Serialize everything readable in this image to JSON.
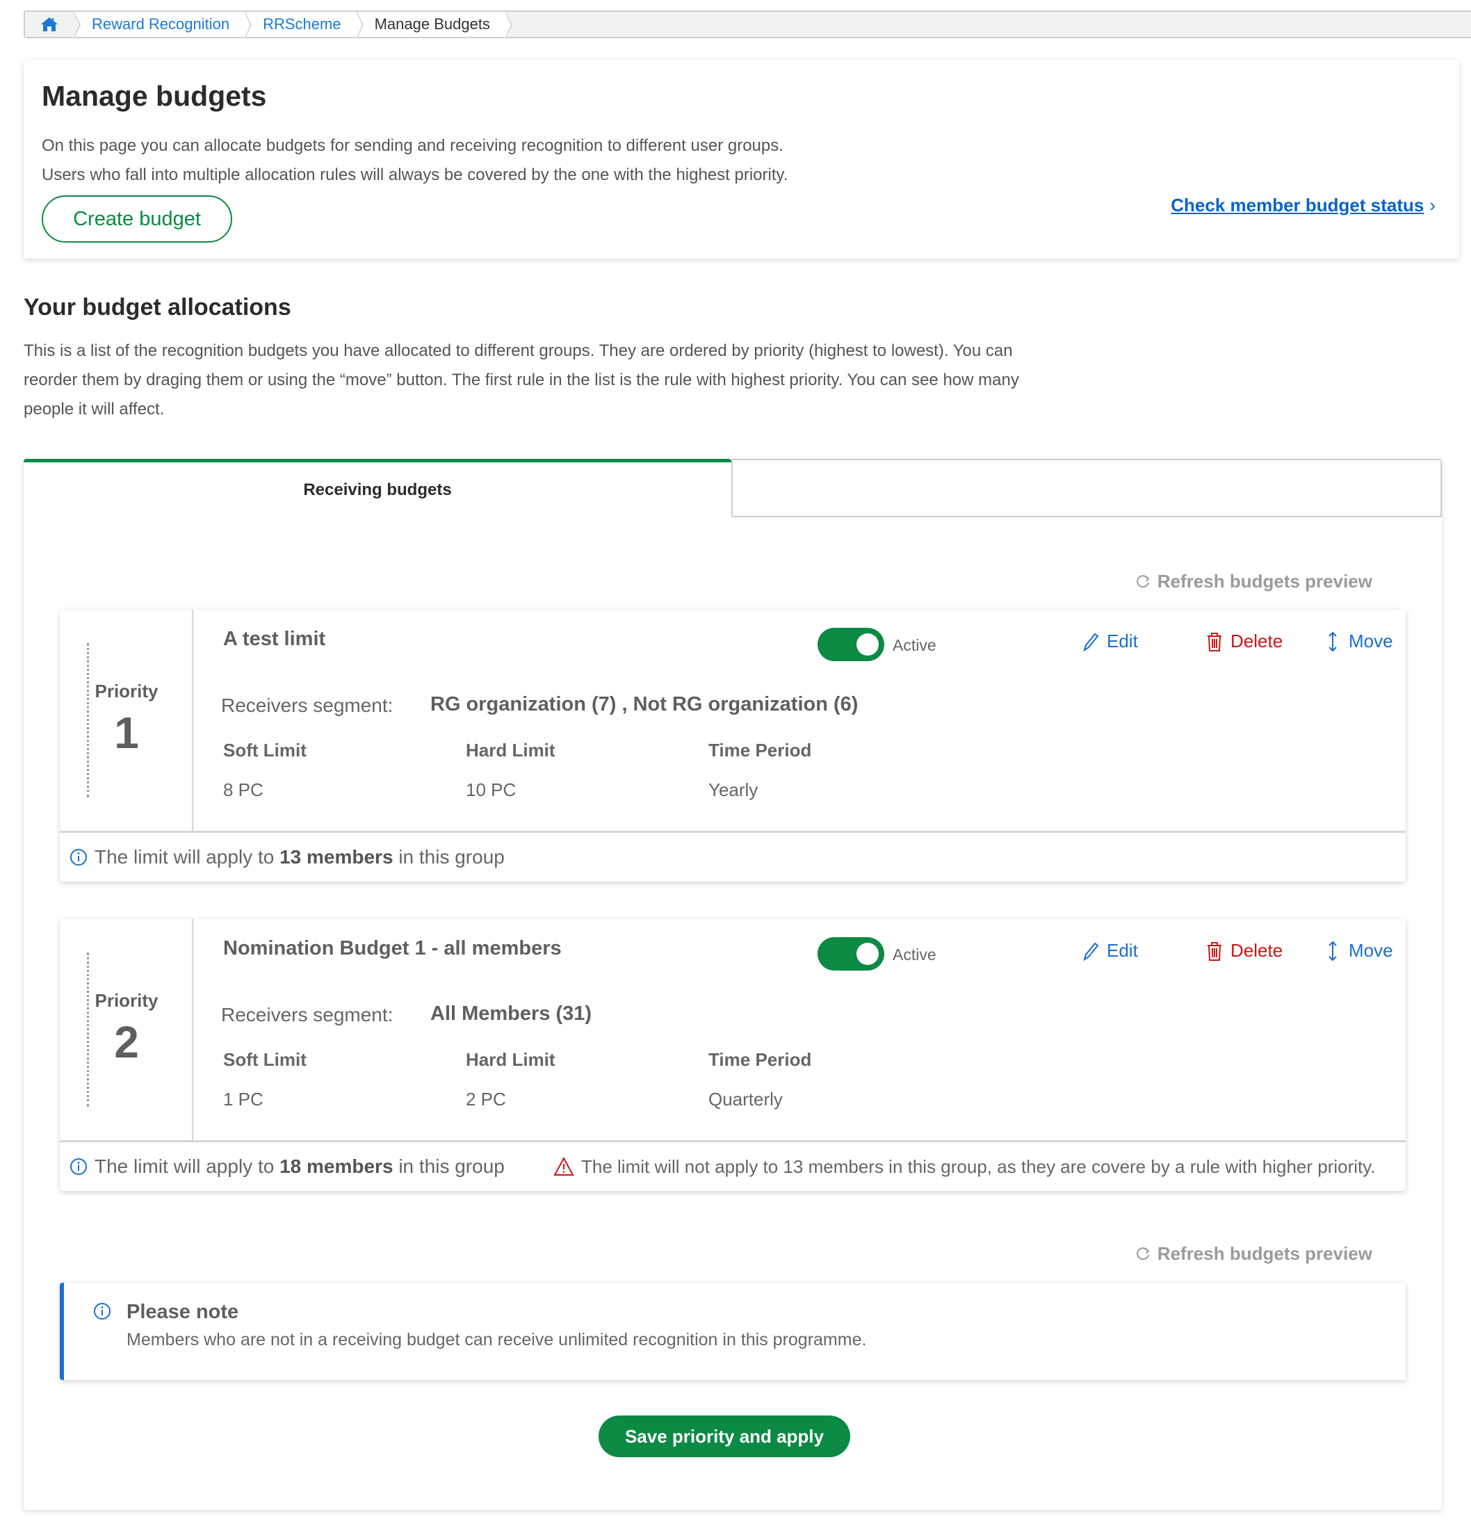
{
  "breadcrumb": {
    "home_icon": "home-icon",
    "items": [
      {
        "label": "Reward Recognition",
        "link": true
      },
      {
        "label": "RRScheme",
        "link": true
      },
      {
        "label": "Manage Budgets",
        "link": false
      }
    ]
  },
  "header": {
    "title": "Manage budgets",
    "intro_line1": "On this page you can allocate budgets for sending and receiving recognition to different user groups.",
    "intro_line2": "Users who fall into multiple allocation rules will always be covered by the one with the highest priority.",
    "create_button": "Create budget",
    "check_link": "Check member budget status",
    "check_link_chevron": "›"
  },
  "allocations": {
    "title": "Your budget allocations",
    "description": "This is a list of the recognition budgets you have allocated to different groups. They are ordered by priority (highest to lowest). You can reorder them by draging them or using the “move” button. The first rule in the list is the rule with highest priority. You can see how many people it will affect."
  },
  "tabs": [
    {
      "label": "Receiving budgets",
      "active": true
    },
    {
      "label": "",
      "active": false
    }
  ],
  "refresh_label": "Refresh budgets preview",
  "labels": {
    "priority": "Priority",
    "active": "Active",
    "edit": "Edit",
    "delete": "Delete",
    "move": "Move",
    "receivers_segment": "Receivers segment:",
    "soft_limit": "Soft Limit",
    "hard_limit": "Hard Limit",
    "time_period": "Time Period",
    "apply_prefix": "The limit will apply to",
    "apply_suffix": "in this group"
  },
  "budgets": [
    {
      "priority": "1",
      "name": "A test limit",
      "active": true,
      "segment": "RG organization (7) , Not RG organization (6)",
      "soft_limit": "8 PC",
      "hard_limit": "10 PC",
      "time_period": "Yearly",
      "members": "13 members",
      "warning": ""
    },
    {
      "priority": "2",
      "name": "Nomination Budget 1 - all members",
      "active": true,
      "segment": "All Members (31)",
      "soft_limit": "1 PC",
      "hard_limit": "2 PC",
      "time_period": "Quarterly",
      "members": "18 members",
      "warning": "The limit will not apply to 13 members in this group, as they are covere by a rule with higher priority."
    }
  ],
  "note": {
    "title": "Please note",
    "body": "Members who are not in a receiving budget can receive unlimited recognition in this programme."
  },
  "save_button": "Save priority and apply",
  "colors": {
    "primary_green": "#0a8a43",
    "link_blue": "#1a6fd0",
    "danger_red": "#cc1515"
  }
}
